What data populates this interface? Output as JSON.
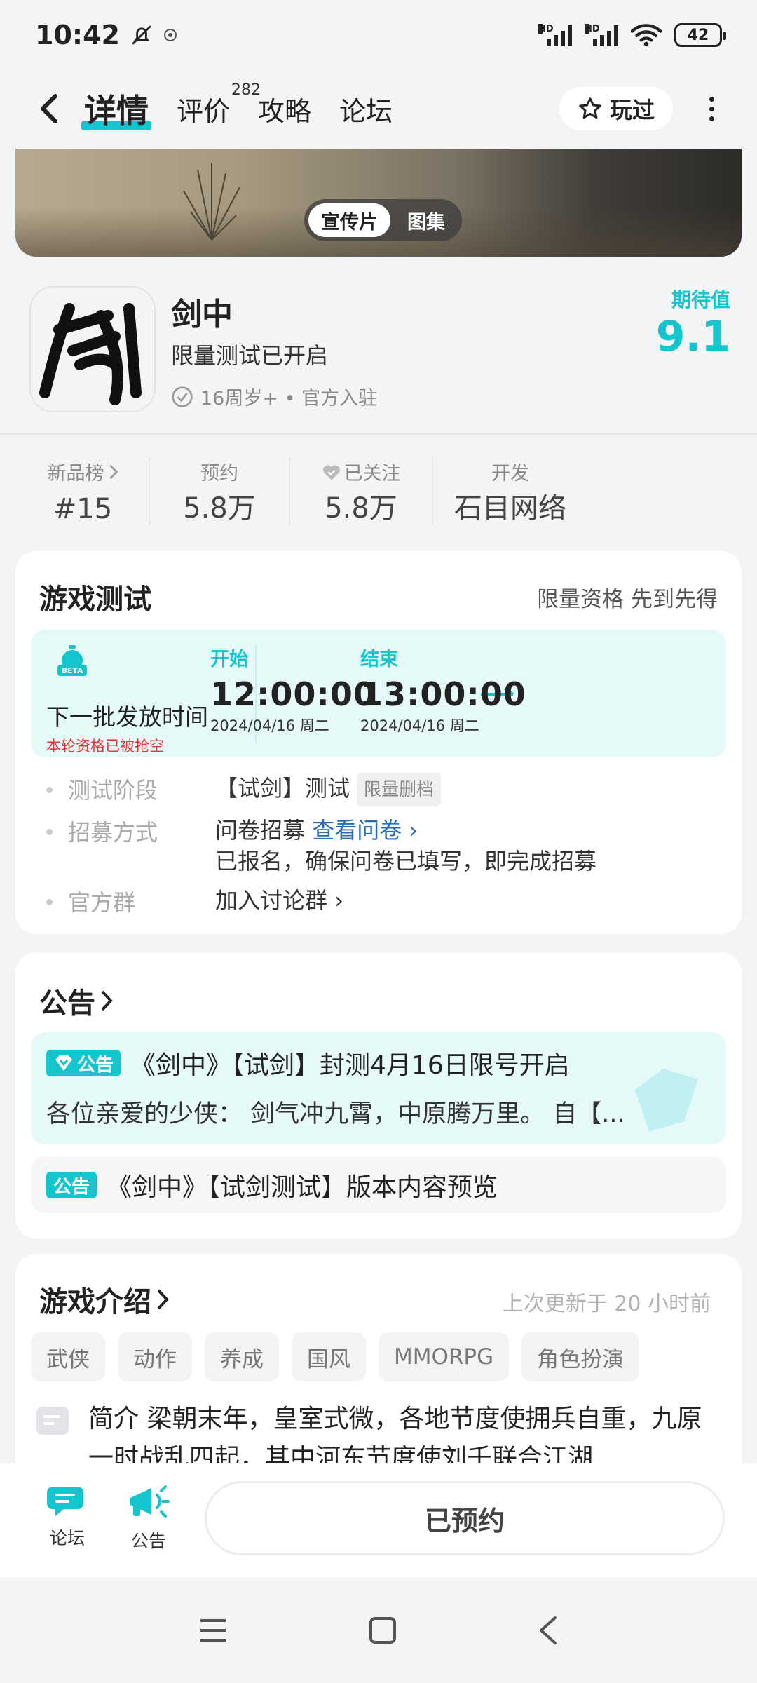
{
  "status": {
    "time": "10:42",
    "battery": "42",
    "hd1": "HD",
    "hd2": "HD"
  },
  "nav": {
    "tabs": [
      {
        "label": "详情"
      },
      {
        "label": "评价",
        "count": "282"
      },
      {
        "label": "攻略"
      },
      {
        "label": "论坛"
      }
    ],
    "played_label": "玩过"
  },
  "banner": {
    "seg_video": "宣传片",
    "seg_gallery": "图集"
  },
  "game": {
    "name": "剑中",
    "subtitle": "限量测试已开启",
    "meta": "16周岁+ • 官方入驻",
    "expect_label": "期待值",
    "expect_score": "9.1"
  },
  "stats": [
    {
      "key": "新品榜",
      "value": "#15"
    },
    {
      "key": "预约",
      "value": "5.8万"
    },
    {
      "key": "已关注",
      "value": "5.8万"
    },
    {
      "key": "开发",
      "value": "石目网络"
    }
  ],
  "test": {
    "title": "游戏测试",
    "note": "限量资格 先到先得",
    "beta": "BETA",
    "next_label": "下一批发放时间",
    "status": "本轮资格已被抢空",
    "start": {
      "label": "开始",
      "time": "12:00:00",
      "date": "2024/04/16  周二"
    },
    "end": {
      "label": "结束",
      "time": "13:00:00",
      "date": "2024/04/16  周二"
    },
    "rows": {
      "stage_key": "测试阶段",
      "stage_value": "【试剑】测试",
      "stage_tag": "限量删档",
      "recruit_key": "招募方式",
      "recruit_value": "问卷招募",
      "recruit_link": "查看问卷",
      "recruit_note": "已报名，确保问卷已填写，即完成招募",
      "group_key": "官方群",
      "group_link": "加入讨论群"
    }
  },
  "announcements": {
    "title": "公告",
    "badge": "公告",
    "items": [
      {
        "title": "《剑中》【试剑】封测4月16日限号开启",
        "preview": "各位亲爱的少侠：  剑气冲九霄，中原腾万里。 自【..."
      },
      {
        "title": "《剑中》【试剑测试】版本内容预览"
      }
    ]
  },
  "intro": {
    "title": "游戏介绍",
    "updated": "上次更新于 20 小时前",
    "tags": [
      "武侠",
      "动作",
      "养成",
      "国风",
      "MMORPG",
      "角色扮演"
    ],
    "text": "简介 梁朝末年，皇室式微，各地节度使拥兵自重，九原一时战乱四起，其中河东节度使刘壬联合江湖"
  },
  "bottom": {
    "forum": "论坛",
    "announce": "公告",
    "reserve": "已预约"
  },
  "colors": {
    "accent": "#15c5ce",
    "alert": "#e03a3a",
    "link": "#2a6bb6"
  }
}
